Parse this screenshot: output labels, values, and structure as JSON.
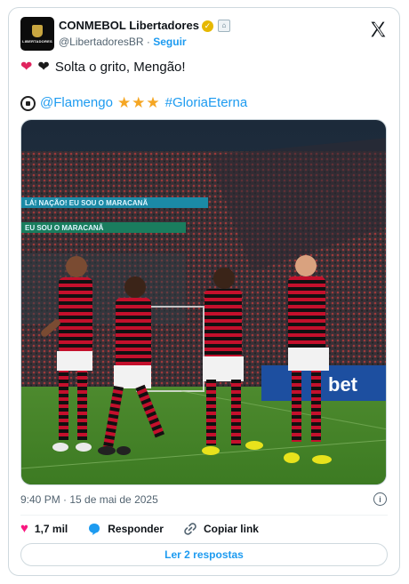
{
  "account": {
    "name": "CONMEBOL Libertadores",
    "handle": "@LibertadoresBR",
    "separator": "·",
    "follow_label": "Seguir",
    "avatar_caption": "LIBERTADORES"
  },
  "tweet": {
    "line1_text": "Solta o grito, Mengão!",
    "mention": "@Flamengo",
    "stars": "★★★",
    "hashtag": "#GloriaEterna",
    "image_banner_1": "LÁ! NAÇÃO! EU SOU O MARACANÃ",
    "image_banner_2": "EU SOU O MARACANÃ",
    "image_ad": "bet"
  },
  "meta": {
    "timestamp": "9:40 PM · 15 de mai de 2025"
  },
  "actions": {
    "likes": "1,7 mil",
    "reply_label": "Responder",
    "copy_label": "Copiar link"
  },
  "footer": {
    "read_replies": "Ler 2 respostas"
  },
  "colors": {
    "link": "#1d9bf0",
    "like": "#f91880",
    "secondary_text": "#536471",
    "border": "#cfd9de"
  }
}
